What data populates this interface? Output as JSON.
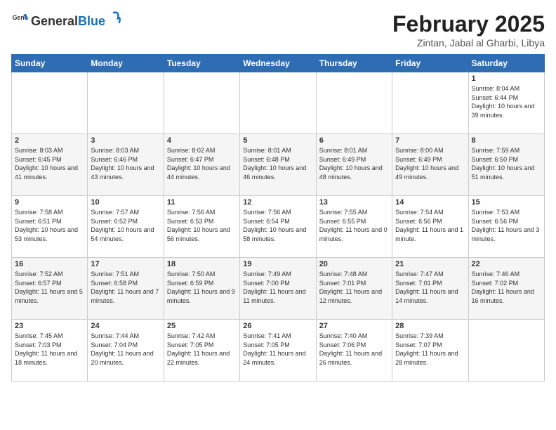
{
  "logo": {
    "general": "General",
    "blue": "Blue"
  },
  "title": "February 2025",
  "subtitle": "Zintan, Jabal al Gharbi, Libya",
  "days_of_week": [
    "Sunday",
    "Monday",
    "Tuesday",
    "Wednesday",
    "Thursday",
    "Friday",
    "Saturday"
  ],
  "weeks": [
    [
      {
        "day": "",
        "info": ""
      },
      {
        "day": "",
        "info": ""
      },
      {
        "day": "",
        "info": ""
      },
      {
        "day": "",
        "info": ""
      },
      {
        "day": "",
        "info": ""
      },
      {
        "day": "",
        "info": ""
      },
      {
        "day": "1",
        "info": "Sunrise: 8:04 AM\nSunset: 6:44 PM\nDaylight: 10 hours and 39 minutes."
      }
    ],
    [
      {
        "day": "2",
        "info": "Sunrise: 8:03 AM\nSunset: 6:45 PM\nDaylight: 10 hours and 41 minutes."
      },
      {
        "day": "3",
        "info": "Sunrise: 8:03 AM\nSunset: 6:46 PM\nDaylight: 10 hours and 43 minutes."
      },
      {
        "day": "4",
        "info": "Sunrise: 8:02 AM\nSunset: 6:47 PM\nDaylight: 10 hours and 44 minutes."
      },
      {
        "day": "5",
        "info": "Sunrise: 8:01 AM\nSunset: 6:48 PM\nDaylight: 10 hours and 46 minutes."
      },
      {
        "day": "6",
        "info": "Sunrise: 8:01 AM\nSunset: 6:49 PM\nDaylight: 10 hours and 48 minutes."
      },
      {
        "day": "7",
        "info": "Sunrise: 8:00 AM\nSunset: 6:49 PM\nDaylight: 10 hours and 49 minutes."
      },
      {
        "day": "8",
        "info": "Sunrise: 7:59 AM\nSunset: 6:50 PM\nDaylight: 10 hours and 51 minutes."
      }
    ],
    [
      {
        "day": "9",
        "info": "Sunrise: 7:58 AM\nSunset: 6:51 PM\nDaylight: 10 hours and 53 minutes."
      },
      {
        "day": "10",
        "info": "Sunrise: 7:57 AM\nSunset: 6:52 PM\nDaylight: 10 hours and 54 minutes."
      },
      {
        "day": "11",
        "info": "Sunrise: 7:56 AM\nSunset: 6:53 PM\nDaylight: 10 hours and 56 minutes."
      },
      {
        "day": "12",
        "info": "Sunrise: 7:56 AM\nSunset: 6:54 PM\nDaylight: 10 hours and 58 minutes."
      },
      {
        "day": "13",
        "info": "Sunrise: 7:55 AM\nSunset: 6:55 PM\nDaylight: 11 hours and 0 minutes."
      },
      {
        "day": "14",
        "info": "Sunrise: 7:54 AM\nSunset: 6:56 PM\nDaylight: 11 hours and 1 minute."
      },
      {
        "day": "15",
        "info": "Sunrise: 7:53 AM\nSunset: 6:56 PM\nDaylight: 11 hours and 3 minutes."
      }
    ],
    [
      {
        "day": "16",
        "info": "Sunrise: 7:52 AM\nSunset: 6:57 PM\nDaylight: 11 hours and 5 minutes."
      },
      {
        "day": "17",
        "info": "Sunrise: 7:51 AM\nSunset: 6:58 PM\nDaylight: 11 hours and 7 minutes."
      },
      {
        "day": "18",
        "info": "Sunrise: 7:50 AM\nSunset: 6:59 PM\nDaylight: 11 hours and 9 minutes."
      },
      {
        "day": "19",
        "info": "Sunrise: 7:49 AM\nSunset: 7:00 PM\nDaylight: 11 hours and 11 minutes."
      },
      {
        "day": "20",
        "info": "Sunrise: 7:48 AM\nSunset: 7:01 PM\nDaylight: 11 hours and 12 minutes."
      },
      {
        "day": "21",
        "info": "Sunrise: 7:47 AM\nSunset: 7:01 PM\nDaylight: 11 hours and 14 minutes."
      },
      {
        "day": "22",
        "info": "Sunrise: 7:46 AM\nSunset: 7:02 PM\nDaylight: 11 hours and 16 minutes."
      }
    ],
    [
      {
        "day": "23",
        "info": "Sunrise: 7:45 AM\nSunset: 7:03 PM\nDaylight: 11 hours and 18 minutes."
      },
      {
        "day": "24",
        "info": "Sunrise: 7:44 AM\nSunset: 7:04 PM\nDaylight: 11 hours and 20 minutes."
      },
      {
        "day": "25",
        "info": "Sunrise: 7:42 AM\nSunset: 7:05 PM\nDaylight: 11 hours and 22 minutes."
      },
      {
        "day": "26",
        "info": "Sunrise: 7:41 AM\nSunset: 7:05 PM\nDaylight: 11 hours and 24 minutes."
      },
      {
        "day": "27",
        "info": "Sunrise: 7:40 AM\nSunset: 7:06 PM\nDaylight: 11 hours and 26 minutes."
      },
      {
        "day": "28",
        "info": "Sunrise: 7:39 AM\nSunset: 7:07 PM\nDaylight: 11 hours and 28 minutes."
      },
      {
        "day": "",
        "info": ""
      }
    ]
  ]
}
